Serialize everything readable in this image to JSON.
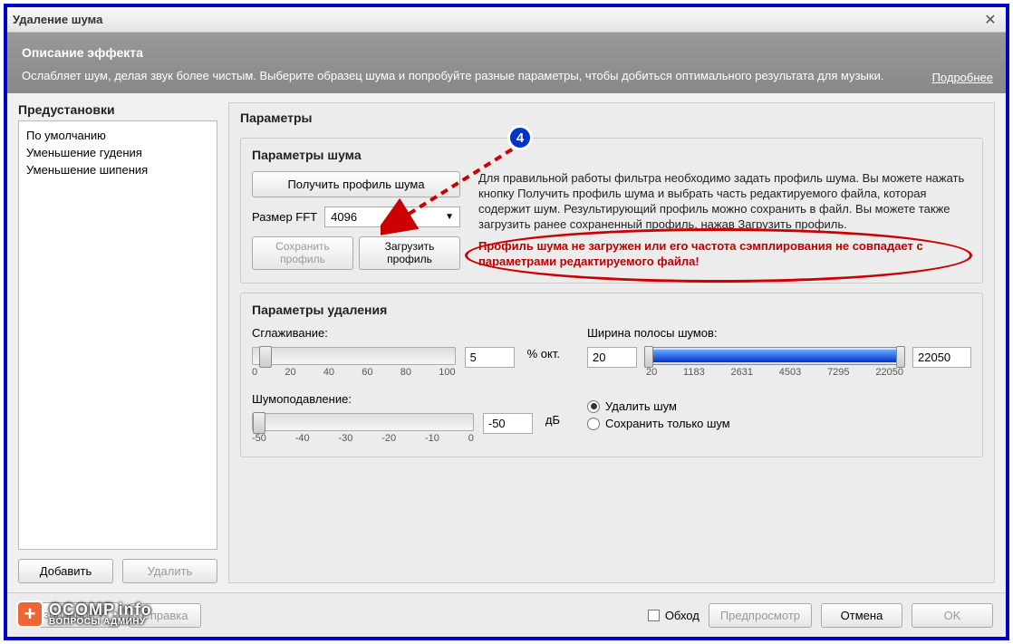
{
  "title": "Удаление шума",
  "description": {
    "title": "Описание эффекта",
    "text": "Ослабляет шум, делая звук более чистым. Выберите образец шума и попробуйте разные параметры, чтобы добиться оптимального результата для музыки.",
    "more": "Подробнее"
  },
  "presets": {
    "title": "Предустановки",
    "items": [
      "По умолчанию",
      "Уменьшение гудения",
      "Уменьшение шипения"
    ],
    "add": "Добавить",
    "remove": "Удалить"
  },
  "params": {
    "title": "Параметры",
    "noise": {
      "title": "Параметры шума",
      "get_profile": "Получить профиль шума",
      "help": "Для правильной работы фильтра необходимо задать профиль шума. Вы можете нажать кнопку Получить профиль шума и выбрать часть редактируемого файла, которая содержит шум. Результирующий профиль можно сохранить в файл. Вы можете также загрузить ранее сохраненный профиль, нажав Загрузить профиль.",
      "fft_label": "Размер FFT",
      "fft_value": "4096",
      "save_profile": "Сохранить профиль",
      "load_profile": "Загрузить профиль",
      "error": "Профиль шума не загружен или его частота сэмплирования не совпадает с параметрами редактируемого файла!"
    },
    "removal": {
      "title": "Параметры удаления",
      "smoothing_label": "Сглаживание:",
      "smoothing_value": "5",
      "smoothing_unit": "% окт.",
      "smoothing_ticks": [
        "0",
        "20",
        "40",
        "60",
        "80",
        "100"
      ],
      "reduction_label": "Шумоподавление:",
      "reduction_value": "-50",
      "reduction_unit": "дБ",
      "reduction_ticks": [
        "-50",
        "-40",
        "-30",
        "-20",
        "-10",
        "0"
      ],
      "band_label": "Ширина полосы шумов:",
      "band_low": "20",
      "band_high": "22050",
      "band_ticks": [
        "20",
        "1183",
        "2631",
        "4503",
        "7295",
        "22050"
      ],
      "mode_remove": "Удалить шум",
      "mode_keep": "Сохранить только шум"
    }
  },
  "footer": {
    "bypass": "Обход",
    "preview": "Предпросмотр",
    "cancel": "Отмена",
    "ok": "OK"
  },
  "annotation": {
    "badge": "4"
  },
  "watermark": {
    "top": "OCOMP.info",
    "bottom": "ВОПРОСЫ АДМИНУ"
  }
}
